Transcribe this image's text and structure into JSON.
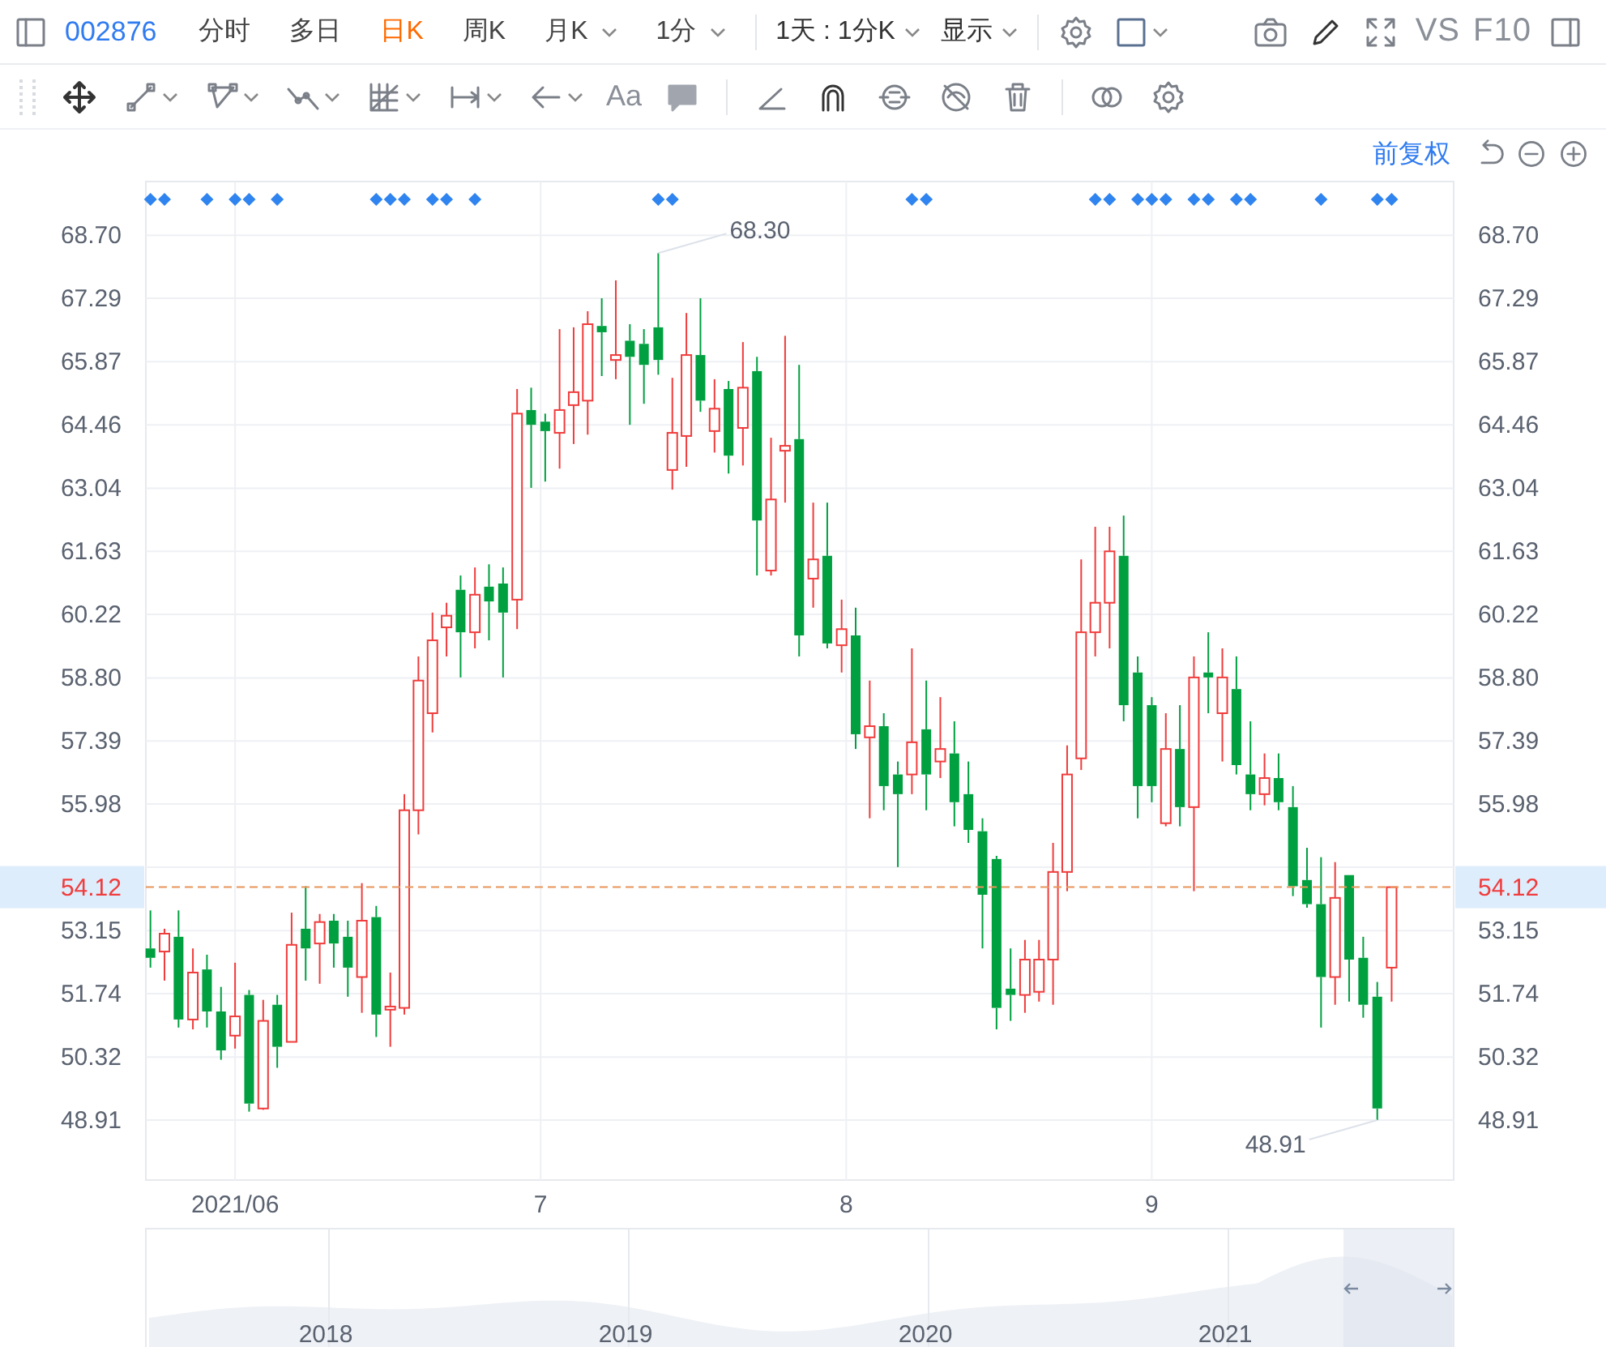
{
  "toolbar": {
    "code": "002876",
    "periods": [
      {
        "label": "分时",
        "selected": false,
        "has_menu": false
      },
      {
        "label": "多日",
        "selected": false,
        "has_menu": false
      },
      {
        "label": "日K",
        "selected": true,
        "has_menu": false
      },
      {
        "label": "周K",
        "selected": false,
        "has_menu": false
      },
      {
        "label": "月K",
        "selected": false,
        "has_menu": true
      },
      {
        "label": "1分",
        "selected": false,
        "has_menu": true
      }
    ],
    "range": {
      "label": "1天 : 1分K"
    },
    "display": {
      "label": "显示"
    },
    "compare": "VS",
    "f10": "F10"
  },
  "drawing_tools": {
    "text_tool": "Aa"
  },
  "adjust_mode": {
    "label": "前复权"
  },
  "chart": {
    "chart_data": {
      "type": "candlestick",
      "x": [
        5.723,
        5.769,
        5.815,
        5.862,
        5.908,
        5.954,
        6.0,
        6.046,
        6.092,
        6.138,
        6.185,
        6.231,
        6.277,
        6.323,
        6.369,
        6.415,
        6.462,
        6.508,
        6.554,
        6.6,
        6.646,
        6.692,
        6.738,
        6.785,
        6.831,
        6.877,
        6.923,
        6.969,
        7.015,
        7.062,
        7.108,
        7.154,
        7.2,
        7.246,
        7.292,
        7.338,
        7.385,
        7.431,
        7.477,
        7.523,
        7.569,
        7.615,
        7.662,
        7.708,
        7.754,
        7.8,
        7.846,
        7.892,
        7.938,
        7.985,
        8.031,
        8.077,
        8.123,
        8.169,
        8.215,
        8.262,
        8.308,
        8.354,
        8.4,
        8.446,
        8.492,
        8.538,
        8.585,
        8.631,
        8.677,
        8.723,
        8.769,
        8.815,
        8.862,
        8.908,
        8.954,
        9.0,
        9.046,
        9.092,
        9.138,
        9.185,
        9.231,
        9.277,
        9.323,
        9.369,
        9.415,
        9.462,
        9.508,
        9.554,
        9.6,
        9.646,
        9.692,
        9.738,
        9.785
      ],
      "xlim": [
        5.708,
        9.988
      ],
      "ohlc": [
        [
          52.75,
          53.6,
          52.32,
          52.54
        ],
        [
          52.68,
          53.19,
          52.03,
          53.08
        ],
        [
          53.01,
          53.6,
          50.98,
          51.16
        ],
        [
          51.16,
          52.75,
          50.94,
          52.21
        ],
        [
          52.28,
          52.61,
          50.98,
          51.34
        ],
        [
          51.34,
          51.89,
          50.26,
          50.47
        ],
        [
          50.8,
          52.43,
          50.51,
          51.23
        ],
        [
          51.71,
          51.82,
          49.1,
          49.28
        ],
        [
          49.17,
          51.6,
          49.14,
          51.13
        ],
        [
          51.49,
          51.71,
          50.08,
          50.55
        ],
        [
          50.66,
          53.55,
          50.66,
          52.83
        ],
        [
          53.19,
          54.14,
          52.03,
          52.75
        ],
        [
          52.86,
          53.52,
          51.96,
          53.34
        ],
        [
          53.37,
          53.52,
          52.32,
          52.86
        ],
        [
          53.01,
          53.37,
          51.67,
          52.32
        ],
        [
          52.11,
          54.21,
          51.31,
          53.37
        ],
        [
          53.45,
          53.7,
          50.77,
          51.27
        ],
        [
          51.38,
          52.21,
          50.55,
          51.45
        ],
        [
          51.42,
          56.2,
          51.27,
          55.84
        ],
        [
          55.84,
          59.28,
          55.3,
          58.74
        ],
        [
          58.01,
          60.26,
          57.58,
          59.64
        ],
        [
          59.93,
          60.48,
          59.28,
          60.19
        ],
        [
          60.77,
          61.09,
          58.81,
          59.82
        ],
        [
          59.82,
          61.27,
          59.46,
          60.66
        ],
        [
          60.84,
          61.34,
          59.64,
          60.51
        ],
        [
          60.91,
          61.27,
          58.81,
          60.26
        ],
        [
          60.55,
          65.26,
          59.89,
          64.71
        ],
        [
          64.79,
          65.29,
          63.05,
          64.46
        ],
        [
          64.53,
          64.71,
          63.19,
          64.32
        ],
        [
          64.28,
          66.6,
          63.48,
          64.79
        ],
        [
          64.9,
          66.64,
          64.03,
          65.19
        ],
        [
          65.0,
          67.0,
          64.24,
          66.71
        ],
        [
          66.67,
          67.29,
          65.55,
          66.53
        ],
        [
          65.91,
          67.69,
          65.48,
          66.02
        ],
        [
          66.34,
          66.71,
          64.46,
          65.98
        ],
        [
          66.27,
          66.6,
          64.93,
          65.8
        ],
        [
          66.64,
          68.3,
          65.58,
          65.91
        ],
        [
          63.45,
          65.51,
          63.01,
          64.28
        ],
        [
          64.21,
          66.96,
          63.52,
          66.02
        ],
        [
          66.02,
          67.29,
          64.75,
          65.0
        ],
        [
          64.32,
          65.48,
          63.84,
          64.82
        ],
        [
          65.26,
          65.44,
          63.37,
          63.77
        ],
        [
          64.39,
          66.31,
          63.55,
          65.29
        ],
        [
          65.66,
          65.98,
          61.09,
          62.32
        ],
        [
          61.2,
          64.17,
          61.09,
          62.79
        ],
        [
          63.88,
          66.45,
          62.72,
          63.99
        ],
        [
          64.14,
          65.8,
          59.28,
          59.75
        ],
        [
          61.02,
          62.72,
          60.37,
          61.45
        ],
        [
          61.53,
          62.72,
          59.46,
          59.57
        ],
        [
          59.53,
          60.55,
          58.92,
          59.89
        ],
        [
          59.75,
          60.37,
          57.21,
          57.54
        ],
        [
          57.47,
          58.74,
          55.66,
          57.72
        ],
        [
          57.72,
          58.01,
          55.84,
          56.38
        ],
        [
          56.64,
          56.93,
          54.57,
          56.2
        ],
        [
          56.64,
          59.46,
          56.2,
          57.36
        ],
        [
          57.65,
          58.74,
          55.84,
          56.64
        ],
        [
          56.93,
          58.37,
          56.56,
          57.21
        ],
        [
          57.11,
          57.83,
          55.48,
          56.02
        ],
        [
          56.2,
          56.93,
          55.11,
          55.4
        ],
        [
          55.37,
          55.66,
          52.75,
          53.95
        ],
        [
          54.75,
          54.82,
          50.94,
          51.42
        ],
        [
          51.85,
          52.75,
          51.13,
          51.71
        ],
        [
          51.71,
          52.94,
          51.31,
          52.5
        ],
        [
          51.78,
          52.94,
          51.56,
          52.5
        ],
        [
          52.5,
          55.11,
          51.49,
          54.46
        ],
        [
          54.46,
          57.29,
          54.03,
          56.64
        ],
        [
          57.0,
          61.45,
          56.74,
          59.82
        ],
        [
          59.82,
          62.18,
          59.28,
          60.48
        ],
        [
          60.48,
          62.18,
          59.46,
          61.63
        ],
        [
          61.53,
          62.43,
          57.83,
          58.19
        ],
        [
          58.92,
          59.28,
          55.66,
          56.38
        ],
        [
          58.19,
          58.37,
          56.02,
          56.38
        ],
        [
          55.55,
          58.01,
          55.48,
          57.21
        ],
        [
          57.21,
          58.19,
          55.48,
          55.91
        ],
        [
          55.91,
          59.28,
          54.03,
          58.81
        ],
        [
          58.92,
          59.82,
          58.01,
          58.81
        ],
        [
          58.01,
          59.46,
          56.93,
          58.81
        ],
        [
          58.55,
          59.28,
          56.64,
          56.85
        ],
        [
          56.64,
          57.83,
          55.84,
          56.2
        ],
        [
          56.2,
          57.11,
          55.95,
          56.56
        ],
        [
          56.56,
          57.11,
          55.84,
          56.02
        ],
        [
          55.91,
          56.38,
          53.92,
          54.14
        ],
        [
          54.28,
          55.0,
          53.66,
          53.74
        ],
        [
          53.74,
          54.79,
          50.98,
          52.11
        ],
        [
          52.11,
          54.68,
          51.49,
          53.88
        ],
        [
          54.39,
          54.39,
          51.56,
          52.5
        ],
        [
          52.54,
          53.01,
          51.2,
          51.49
        ],
        [
          51.67,
          52.0,
          48.91,
          49.17
        ],
        [
          52.32,
          54.12,
          51.56,
          54.12
        ]
      ],
      "ylim": [
        47.57,
        69.9
      ],
      "y2lim": [
        47.57,
        69.9
      ],
      "xticks": [
        {
          "value": 6,
          "label": "2021/06"
        },
        {
          "value": 7,
          "label": "7"
        },
        {
          "value": 8,
          "label": "8"
        },
        {
          "value": 9,
          "label": "9"
        }
      ],
      "yticks": [
        {
          "value": 48.91,
          "label": "48.91"
        },
        {
          "value": 50.32,
          "label": "50.32"
        },
        {
          "value": 51.74,
          "label": "51.74"
        },
        {
          "value": 53.15,
          "label": "53.15"
        },
        {
          "value": 55.98,
          "label": "55.98"
        },
        {
          "value": 57.39,
          "label": "57.39"
        },
        {
          "value": 58.8,
          "label": "58.80"
        },
        {
          "value": 60.22,
          "label": "60.22"
        },
        {
          "value": 61.63,
          "label": "61.63"
        },
        {
          "value": 63.04,
          "label": "63.04"
        },
        {
          "value": 64.46,
          "label": "64.46"
        },
        {
          "value": 65.87,
          "label": "65.87"
        },
        {
          "value": 67.29,
          "label": "67.29"
        },
        {
          "value": 68.7,
          "label": "68.70"
        }
      ],
      "y2ticks": [
        {
          "value": 48.91,
          "label": "48.91"
        },
        {
          "value": 50.32,
          "label": "50.32"
        },
        {
          "value": 51.74,
          "label": "51.74"
        },
        {
          "value": 53.15,
          "label": "53.15"
        },
        {
          "value": 55.98,
          "label": "55.98"
        },
        {
          "value": 57.39,
          "label": "57.39"
        },
        {
          "value": 58.8,
          "label": "58.80"
        },
        {
          "value": 60.22,
          "label": "60.22"
        },
        {
          "value": 61.63,
          "label": "61.63"
        },
        {
          "value": 63.04,
          "label": "63.04"
        },
        {
          "value": 64.46,
          "label": "64.46"
        },
        {
          "value": 65.87,
          "label": "65.87"
        },
        {
          "value": 67.29,
          "label": "67.29"
        },
        {
          "value": 68.7,
          "label": "68.70"
        }
      ],
      "annotations": [
        {
          "x": 7.385,
          "y": 68.3,
          "text": "68.30"
        },
        {
          "x": 9.738,
          "y": 48.91,
          "text": "48.91"
        },
        "54.12"
      ],
      "grid": true,
      "ref_lines": [
        {
          "axis": "y",
          "value": 54.12,
          "label": "54.12",
          "color": "#e8955a"
        }
      ]
    },
    "candle_markers": [
      true,
      true,
      false,
      false,
      true,
      false,
      true,
      true,
      false,
      true,
      false,
      false,
      false,
      false,
      false,
      false,
      true,
      true,
      true,
      false,
      true,
      true,
      false,
      true,
      false,
      false,
      false,
      false,
      false,
      false,
      false,
      false,
      false,
      false,
      false,
      false,
      true,
      true,
      false,
      false,
      false,
      false,
      false,
      false,
      false,
      false,
      false,
      false,
      false,
      false,
      false,
      false,
      false,
      false,
      true,
      true,
      false,
      false,
      false,
      false,
      false,
      false,
      false,
      false,
      false,
      false,
      false,
      true,
      true,
      false,
      true,
      true,
      true,
      false,
      true,
      true,
      false,
      true,
      true,
      false,
      false,
      false,
      false,
      true,
      false,
      false,
      false,
      true,
      true
    ]
  },
  "navigator": {
    "years": [
      "2018",
      "2019",
      "2020",
      "2021"
    ]
  }
}
